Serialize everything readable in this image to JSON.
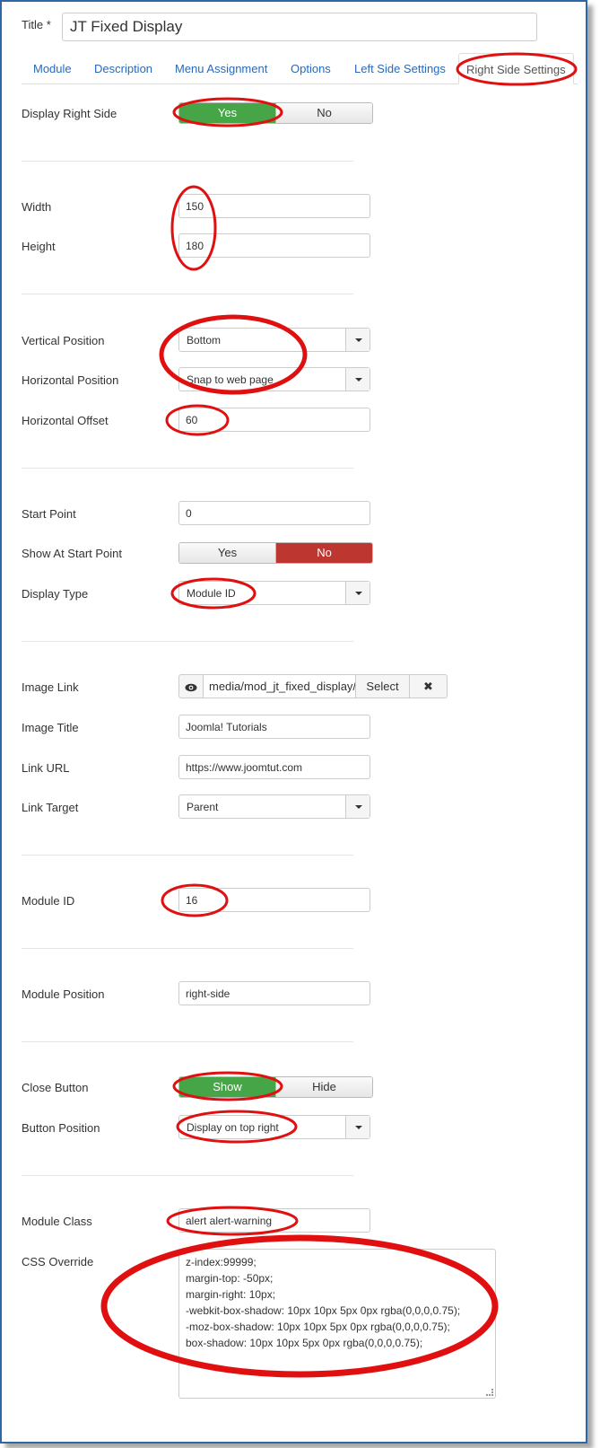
{
  "title_field": {
    "label": "Title *",
    "value": "JT Fixed Display"
  },
  "tabs": [
    {
      "label": "Module"
    },
    {
      "label": "Description"
    },
    {
      "label": "Menu Assignment"
    },
    {
      "label": "Options"
    },
    {
      "label": "Left Side Settings"
    },
    {
      "label": "Right Side Settings",
      "active": true
    }
  ],
  "fields": {
    "display_right_side": {
      "label": "Display Right Side",
      "yes": "Yes",
      "no": "No",
      "selected": "Yes"
    },
    "width": {
      "label": "Width",
      "value": "150"
    },
    "height": {
      "label": "Height",
      "value": "180"
    },
    "vertical_position": {
      "label": "Vertical Position",
      "value": "Bottom"
    },
    "horizontal_position": {
      "label": "Horizontal Position",
      "value": "Snap to web page"
    },
    "horizontal_offset": {
      "label": "Horizontal Offset",
      "value": "60"
    },
    "start_point": {
      "label": "Start Point",
      "value": "0"
    },
    "show_at_start_point": {
      "label": "Show At Start Point",
      "yes": "Yes",
      "no": "No",
      "selected": "No"
    },
    "display_type": {
      "label": "Display Type",
      "value": "Module ID"
    },
    "image_link": {
      "label": "Image Link",
      "value": "media/mod_jt_fixed_display/",
      "select_label": "Select",
      "clear_label": "✖"
    },
    "image_title": {
      "label": "Image Title",
      "value": "Joomla! Tutorials"
    },
    "link_url": {
      "label": "Link URL",
      "value": "https://www.joomtut.com"
    },
    "link_target": {
      "label": "Link Target",
      "value": "Parent"
    },
    "module_id": {
      "label": "Module ID",
      "value": "16"
    },
    "module_position": {
      "label": "Module Position",
      "value": "right-side"
    },
    "close_button": {
      "label": "Close Button",
      "show": "Show",
      "hide": "Hide",
      "selected": "Show"
    },
    "button_position": {
      "label": "Button Position",
      "value": "Display on top right"
    },
    "module_class": {
      "label": "Module Class",
      "value": "alert alert-warning"
    },
    "css_override": {
      "label": "CSS Override",
      "lines": [
        "z-index:99999;",
        "margin-top: -50px;",
        "margin-right: 10px;",
        "-webkit-box-shadow: 10px 10px 5px 0px rgba(0,0,0,0.75);",
        "-moz-box-shadow: 10px 10px 5px 0px rgba(0,0,0,0.75);",
        "box-shadow: 10px 10px 5px 0px rgba(0,0,0,0.75);"
      ]
    }
  },
  "icons": {
    "eye": "eye-icon",
    "clear": "clear-icon",
    "caret": "chevron-down-icon"
  },
  "colors": {
    "accent_link": "#2a69b8",
    "toggle_green": "#46a546",
    "toggle_red": "#bd362f",
    "annotation": "#e01010",
    "frame": "#2e66a8"
  }
}
